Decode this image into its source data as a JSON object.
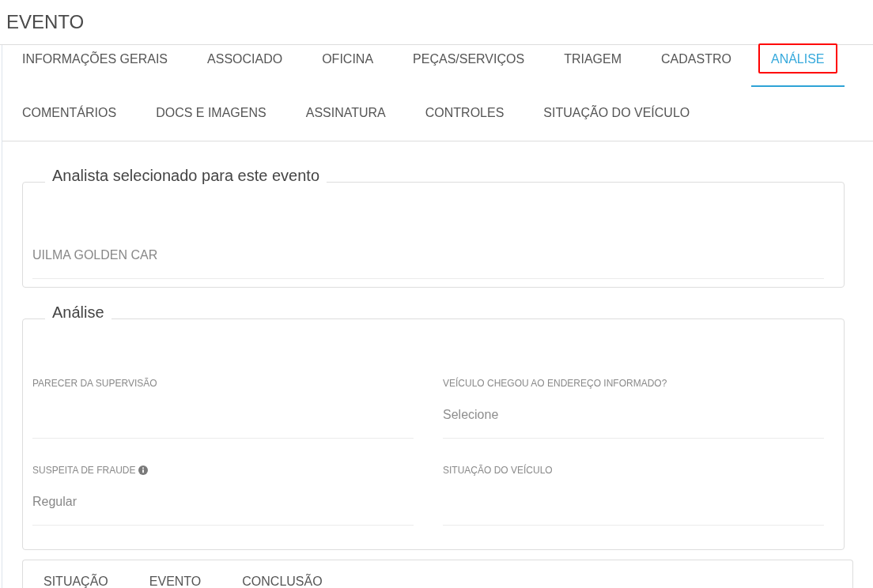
{
  "page": {
    "title": "EVENTO"
  },
  "tabs": [
    {
      "label": "INFORMAÇÕES GERAIS",
      "selected": false,
      "highlighted": false
    },
    {
      "label": "ASSOCIADO",
      "selected": false,
      "highlighted": false
    },
    {
      "label": "OFICINA",
      "selected": false,
      "highlighted": false
    },
    {
      "label": "PEÇAS/SERVIÇOS",
      "selected": false,
      "highlighted": false
    },
    {
      "label": "TRIAGEM",
      "selected": false,
      "highlighted": false
    },
    {
      "label": "CADASTRO",
      "selected": false,
      "highlighted": false
    },
    {
      "label": "ANÁLISE",
      "selected": true,
      "highlighted": true
    },
    {
      "label": "COMENTÁRIOS",
      "selected": false,
      "highlighted": false
    },
    {
      "label": "DOCS E IMAGENS",
      "selected": false,
      "highlighted": false
    },
    {
      "label": "ASSINATURA",
      "selected": false,
      "highlighted": false
    },
    {
      "label": "CONTROLES",
      "selected": false,
      "highlighted": false
    },
    {
      "label": "SITUAÇÃO DO VEÍCULO",
      "selected": false,
      "highlighted": false
    }
  ],
  "analyst_section": {
    "title": "Analista selecionado para este evento",
    "analyst": {
      "value": "UILMA GOLDEN CAR"
    }
  },
  "analysis_section": {
    "title": "Análise",
    "fields": [
      {
        "label": "PARECER DA SUPERVISÃO",
        "info_icon": false
      },
      {
        "label": "VEÍCULO CHEGOU AO ENDEREÇO INFORMADO?",
        "info_icon": false,
        "placeholder": "Selecione"
      },
      {
        "label": "SUSPEITA DE FRAUDE",
        "info_icon": true,
        "value": "Regular"
      },
      {
        "label": "SITUAÇÃO DO VEÍCULO",
        "info_icon": false
      }
    ]
  },
  "result_tabs": [
    {
      "label": "SITUAÇÃO"
    },
    {
      "label": "EVENTO"
    },
    {
      "label": "CONCLUSÃO"
    }
  ]
}
